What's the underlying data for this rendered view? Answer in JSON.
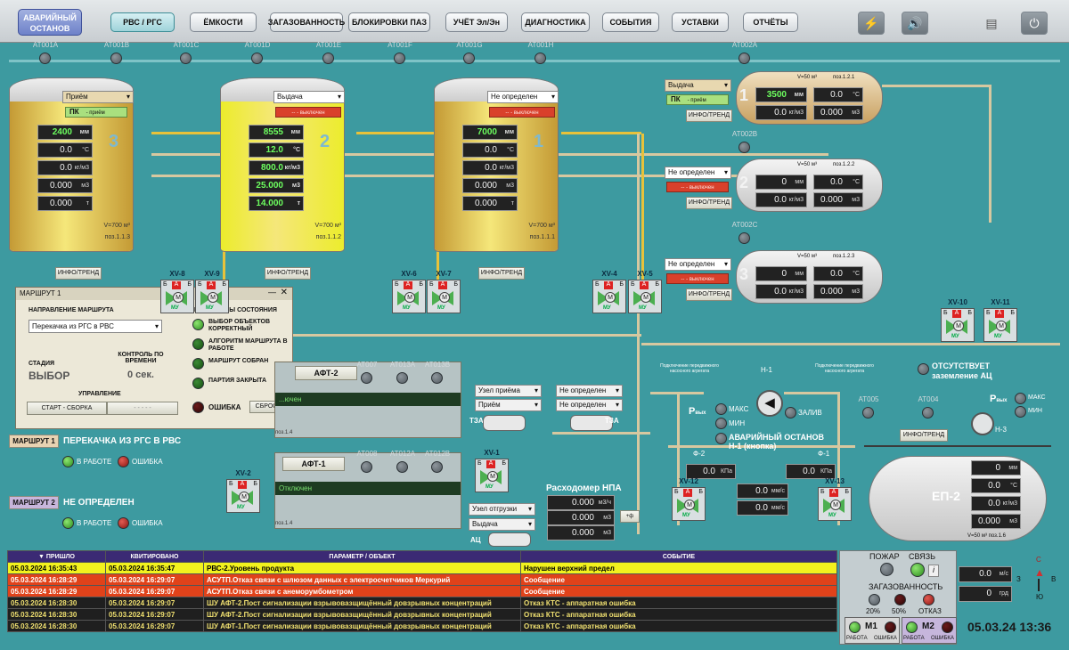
{
  "nav": {
    "emergency": "АВАРИЙНЫЙ ОСТАНОВ",
    "tabs": [
      "РВС / РГС",
      "ЁМКОСТИ",
      "ЗАГАЗОВАННОСТЬ",
      "БЛОКИРОВКИ ПАЗ",
      "УЧЁТ Эл/Эн",
      "ДИАГНОСТИКА",
      "СОБЫТИЯ",
      "УСТАВКИ",
      "ОТЧЁТЫ"
    ],
    "active_tab": "РВС / РГС",
    "icons": [
      "lightning-icon",
      "speaker-icon",
      "export-icon",
      "power-icon"
    ]
  },
  "gas_sensors": [
    "АТ001А",
    "АТ001В",
    "АТ001С",
    "АТ001D",
    "АТ001Е",
    "АТ001F",
    "АТ001G",
    "АТ001Н",
    "АТ002А",
    "АТ002В",
    "АТ002С",
    "АТ005",
    "АТ004",
    "АТ007",
    "АТ013А",
    "АТ013В",
    "АТ008",
    "АТ012А",
    "АТ012В"
  ],
  "tanks": [
    {
      "num": "3",
      "mode": "Приём",
      "status": "ПК",
      "status_sub": "- приём",
      "level": "2400",
      "temp": "0.0",
      "density": "0.0",
      "volume": "0.000",
      "mass": "0.000",
      "vol_label": "V=700 м³",
      "pos": "поз.1.1.3",
      "color": "#c49a35"
    },
    {
      "num": "2",
      "mode": "Выдача",
      "status": "-- - выключен",
      "level": "8555",
      "temp": "12.0",
      "density": "800.0",
      "volume": "25.000",
      "mass": "14.000",
      "vol_label": "V=700 м³",
      "pos": "поз.1.1.2",
      "color": "#ecec2c"
    },
    {
      "num": "1",
      "mode": "Не определен",
      "status": "-- - выключен",
      "level": "7000",
      "temp": "0.0",
      "density": "0.0",
      "volume": "0.000",
      "mass": "0.000",
      "vol_label": "V=700 м³",
      "pos": "поз.1.1.1",
      "color": "#c49a35"
    }
  ],
  "units": {
    "mm": "мм",
    "c": "°С",
    "kgm3": "кг/м3",
    "m3": "м3",
    "t": "т",
    "kpa": "КПа",
    "mms": "мм/с",
    "ms": "м/с",
    "grad": "грд",
    "m3h": "м3/ч"
  },
  "hx": [
    {
      "num": "1",
      "mode": "Выдача",
      "status": "ПК",
      "status_sub": "- приём",
      "level": "3500",
      "temp": "0.0",
      "density": "0.0",
      "mass": "0.000",
      "vol": "V=50 м³",
      "pos": "поз.1.2.1"
    },
    {
      "num": "2",
      "mode": "Не определен",
      "status": "-- - выключен",
      "level": "0",
      "temp": "0.0",
      "density": "0.0",
      "mass": "0.000",
      "vol": "V=50 м³",
      "pos": "поз.1.2.2"
    },
    {
      "num": "3",
      "mode": "Не определен",
      "status": "-- - выключен",
      "level": "0",
      "temp": "0.0",
      "density": "0.0",
      "mass": "0.000",
      "vol": "V=50 м³",
      "pos": "поз.1.2.3"
    }
  ],
  "infotrend": "ИНФО/ТРЕНД",
  "valves": [
    "XV-8",
    "XV-9",
    "XV-6",
    "XV-7",
    "XV-4",
    "XV-5",
    "XV-10",
    "XV-11",
    "XV-2",
    "XV-1",
    "XV-12",
    "XV-13"
  ],
  "valve_tags": {
    "a": "А",
    "b": "Б",
    "m": "М",
    "mu": "МУ"
  },
  "route_dialog": {
    "title": "МАРШРУТ 1",
    "direction_label": "НАПРАВЛЕНИЕ МАРШРУТА",
    "direction_value": "Перекачка из РГС в РВС",
    "stage_label": "СТАДИЯ",
    "stage_value": "ВЫБОР",
    "time_label": "КОНТРОЛЬ ПО ВРЕМЕНИ",
    "time_value": "0 сек.",
    "control_label": "УПРАВЛЕНИЕ",
    "start_btn": "СТАРТ - СБОРКА",
    "second_btn": "- - - - -",
    "indicators_label": "ИНДИКАТОРЫ СОСТОЯНИЯ",
    "indicators": [
      "ВЫБОР ОБЪЕКТОВ КОРРЕКТНЫЙ",
      "АЛГОРИТМ МАРШРУТА В РАБОТЕ",
      "МАРШРУТ СОБРАН",
      "ПАРТИЯ ЗАКРЫТА"
    ],
    "error_label": "ОШИБКА",
    "reset_btn": "СБРОС"
  },
  "routes": [
    {
      "tag": "МАРШРУТ 1",
      "name": "ПЕРЕКАЧКА ИЗ РГС В РВС",
      "work": "В РАБОТЕ",
      "err": "ОШИБКА"
    },
    {
      "tag": "МАРШРУТ 2",
      "name": "НЕ ОПРЕДЕЛЕН",
      "work": "В РАБОТЕ",
      "err": "ОШИБКА"
    }
  ],
  "aft2": {
    "title": "АФТ-2",
    "state": "...ючен",
    "pos": "поз.1.4"
  },
  "aft1": {
    "title": "АФТ-1",
    "state": "Отключен",
    "pos": "поз.1.4"
  },
  "nodes": {
    "intake_node": "Узел приёма",
    "intake": "Приём",
    "ship_node": "Узел отгрузки",
    "ship": "Выдача",
    "nd1": "Не определен",
    "nd2": "Не определен",
    "tza": "ТЗА",
    "ac": "АЦ"
  },
  "flowmeter": {
    "title": "Расходомер НПА",
    "flow": "0.000",
    "v1": "0.000",
    "v2": "0.000",
    "btn": "+ф"
  },
  "pump_area": {
    "conn": "Подключение передвижного насосного агрегата",
    "pump": "Н-1",
    "max": "МАКС",
    "min": "МИН",
    "fill": "ЗАЛИВ",
    "p_out": "Р",
    "p_sub": "вых",
    "emergency": "АВАРИЙНЫЙ ОСТАНОВ Н-1 (кнопка)",
    "f2": "Ф-2",
    "f1": "Ф-1",
    "p2": "0.0",
    "p1": "0.0",
    "vib1": "0.0",
    "vib2": "0.0",
    "no_ground": "ОТСУТСТВУЕТ заземление АЦ",
    "pump3": "Н-3",
    "p3max": "МАКС",
    "p3min": "МИН"
  },
  "ep2": {
    "name": "ЕП-2",
    "level": "0",
    "temp": "0.0",
    "density": "0.0",
    "volume": "0.000",
    "mass": "0.000",
    "vol": "V=50 м³",
    "pos": "поз.1.6"
  },
  "alarms": {
    "headers": [
      "ПРИШЛО",
      "КВИТИРОВАНО",
      "ПАРАМЕТР / ОБЪЕКТ",
      "СОБЫТИЕ"
    ],
    "rows": [
      {
        "cls": "r-yellow",
        "in": "05.03.2024 16:35:43",
        "ack": "05.03.2024 16:35:47",
        "obj": "РВС-2.Уровень продукта",
        "ev": "Нарушен верхний предел"
      },
      {
        "cls": "r-red",
        "in": "05.03.2024 16:28:29",
        "ack": "05.03.2024 16:29:07",
        "obj": "АСУТП.Отказ связи с шлюзом данных с электросчетчиков Меркурий",
        "ev": "Сообщение"
      },
      {
        "cls": "r-red",
        "in": "05.03.2024 16:28:29",
        "ack": "05.03.2024 16:29:07",
        "obj": "АСУТП.Отказ связи с анеморумбометром",
        "ev": "Сообщение"
      },
      {
        "cls": "r-dark",
        "in": "05.03.2024 16:28:30",
        "ack": "05.03.2024 16:29:07",
        "obj": "ШУ АФТ-2.Пост сигнализации взрывовазщищённый довзрывных концентраций",
        "ev": "Отказ КТС - аппаратная ошибка"
      },
      {
        "cls": "r-dark",
        "in": "05.03.2024 16:28:30",
        "ack": "05.03.2024 16:29:07",
        "obj": "ШУ АФТ-2.Пост сигнализации взрывовазщищённый довзрывных концентраций",
        "ev": "Отказ КТС - аппаратная ошибка"
      },
      {
        "cls": "r-dark",
        "in": "05.03.2024 16:28:30",
        "ack": "05.03.2024 16:29:07",
        "obj": "ШУ АФТ-1.Пост сигнализации взрывовазщищённый довзрывных концентраций",
        "ev": "Отказ КТС - аппаратная ошибка"
      }
    ]
  },
  "status_panel": {
    "fire": "ПОЖАР",
    "link": "СВЯЗЬ",
    "info": "i",
    "gas": "ЗАГАЗОВАННОСТЬ",
    "p20": "20%",
    "p50": "50%",
    "fail": "ОТКАЗ",
    "m1": "М1",
    "m2": "М2",
    "work": "РАБОТА",
    "err": "ОШИБКА",
    "wind": "0.0",
    "dir": "0"
  },
  "compass": {
    "n": "С",
    "s": "Ю",
    "w": "З",
    "e": "В"
  },
  "datetime": "05.03.24 13:36"
}
